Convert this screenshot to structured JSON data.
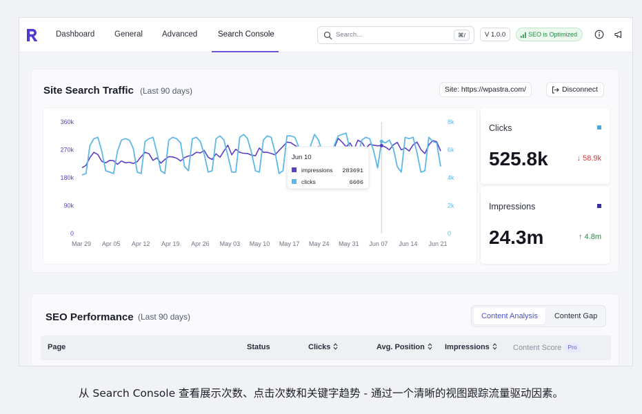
{
  "nav": {
    "tabs": [
      "Dashboard",
      "General",
      "Advanced",
      "Search Console"
    ],
    "active_tab": "Search Console",
    "search_placeholder": "Search...",
    "search_shortcut": "⌘/",
    "version": "V 1.0.0",
    "seo_status": "SEO is Optimized"
  },
  "traffic": {
    "title": "Site Search Traffic",
    "subtitle": "(Last 90 days)",
    "site": "Site: https://wpastra.com/",
    "disconnect": "Disconnect",
    "tooltip": {
      "date": "Jun 10",
      "rows": [
        {
          "label": "impressions",
          "value": "283691"
        },
        {
          "label": "clicks",
          "value": "6606"
        }
      ]
    },
    "stats": {
      "clicks": {
        "label": "Clicks",
        "value": "525.8k",
        "delta": "58.9k",
        "direction": "down"
      },
      "impressions": {
        "label": "Impressions",
        "value": "24.3m",
        "delta": "4.8m",
        "direction": "up"
      }
    }
  },
  "chart_data": {
    "type": "line",
    "x_ticks": [
      "Mar 29",
      "Apr 05",
      "Apr 12",
      "Apr 19",
      "Apr 26",
      "May 03",
      "May 10",
      "May 17",
      "May 24",
      "May 31",
      "Jun 07",
      "Jun 14",
      "Jun 21"
    ],
    "left_ticks": [
      "360k",
      "270k",
      "180k",
      "90k",
      "0"
    ],
    "right_ticks": [
      "8k",
      "6k",
      "4k",
      "2k",
      "0"
    ],
    "ylim_left": [
      0,
      360000
    ],
    "ylim_right": [
      0,
      8000
    ],
    "series": [
      {
        "name": "impressions",
        "axis": "left",
        "color": "#5b3fc6",
        "values": [
          212000,
          220000,
          245000,
          262000,
          255000,
          233000,
          228000,
          236000,
          235000,
          223000,
          234000,
          228000,
          230000,
          226000,
          232000,
          248000,
          262000,
          257000,
          236000,
          244000,
          227000,
          239000,
          248000,
          247000,
          243000,
          234000,
          245000,
          250000,
          253000,
          262000,
          260000,
          268000,
          246000,
          239000,
          257000,
          246000,
          266000,
          285000,
          254000,
          272000,
          262000,
          259000,
          258000,
          253000,
          251000,
          276000,
          262000,
          262000,
          258000,
          254000,
          268000,
          281000,
          295000,
          293000,
          284000,
          278000,
          270000,
          268000,
          273000,
          271000,
          281000,
          268000,
          262000,
          257000,
          276000,
          307000,
          295000,
          280000,
          292000,
          271000,
          301000,
          294000,
          275000,
          288000,
          285000,
          283000,
          283691,
          279000,
          270000,
          286000,
          294000,
          270000,
          276000,
          266000,
          286000,
          295000,
          271000,
          258000,
          286000,
          300000,
          296000,
          266000
        ]
      },
      {
        "name": "clicks",
        "axis": "right",
        "color": "#5cb8e6",
        "values": [
          4200,
          4300,
          6300,
          6800,
          6900,
          5900,
          4500,
          4400,
          4300,
          5900,
          6700,
          6800,
          6700,
          6100,
          4400,
          4300,
          6600,
          6800,
          6900,
          5800,
          4500,
          4300,
          6700,
          6900,
          6800,
          6500,
          4800,
          4500,
          6800,
          6900,
          6600,
          5700,
          4400,
          4500,
          6800,
          7000,
          6700,
          5600,
          4400,
          4400,
          6900,
          7100,
          6800,
          5800,
          4500,
          4400,
          6700,
          7000,
          6900,
          5800,
          4300,
          4500,
          7000,
          7000,
          6900,
          6200,
          4300,
          4300,
          6300,
          7100,
          6700,
          5800,
          4500,
          4400,
          6300,
          7000,
          7100,
          7200,
          6000,
          5000,
          5500,
          6700,
          6900,
          6800,
          5900,
          4700,
          6606,
          6500,
          6700,
          6100,
          4800,
          4400,
          6900,
          6800,
          6900,
          5800,
          4400,
          4500,
          6900,
          6600,
          6500,
          4800
        ]
      }
    ]
  },
  "seo": {
    "title": "SEO Performance",
    "subtitle": "(Last 90 days)",
    "tabs": [
      "Content Analysis",
      "Content Gap"
    ],
    "columns": [
      "Page",
      "Status",
      "Clicks",
      "Avg. Position",
      "Impressions",
      "Content Score"
    ],
    "pro_label": "Pro"
  },
  "colors": {
    "accent": "#6b52d8",
    "impressions": "#5b3fc6",
    "clicks": "#5cb8e6",
    "success": "#1f8f3e",
    "danger": "#d93a3a"
  },
  "caption": "从 Search Console 查看展示次数、点击次数和关键字趋势 - 通过一个清晰的视图跟踪流量驱动因素。"
}
